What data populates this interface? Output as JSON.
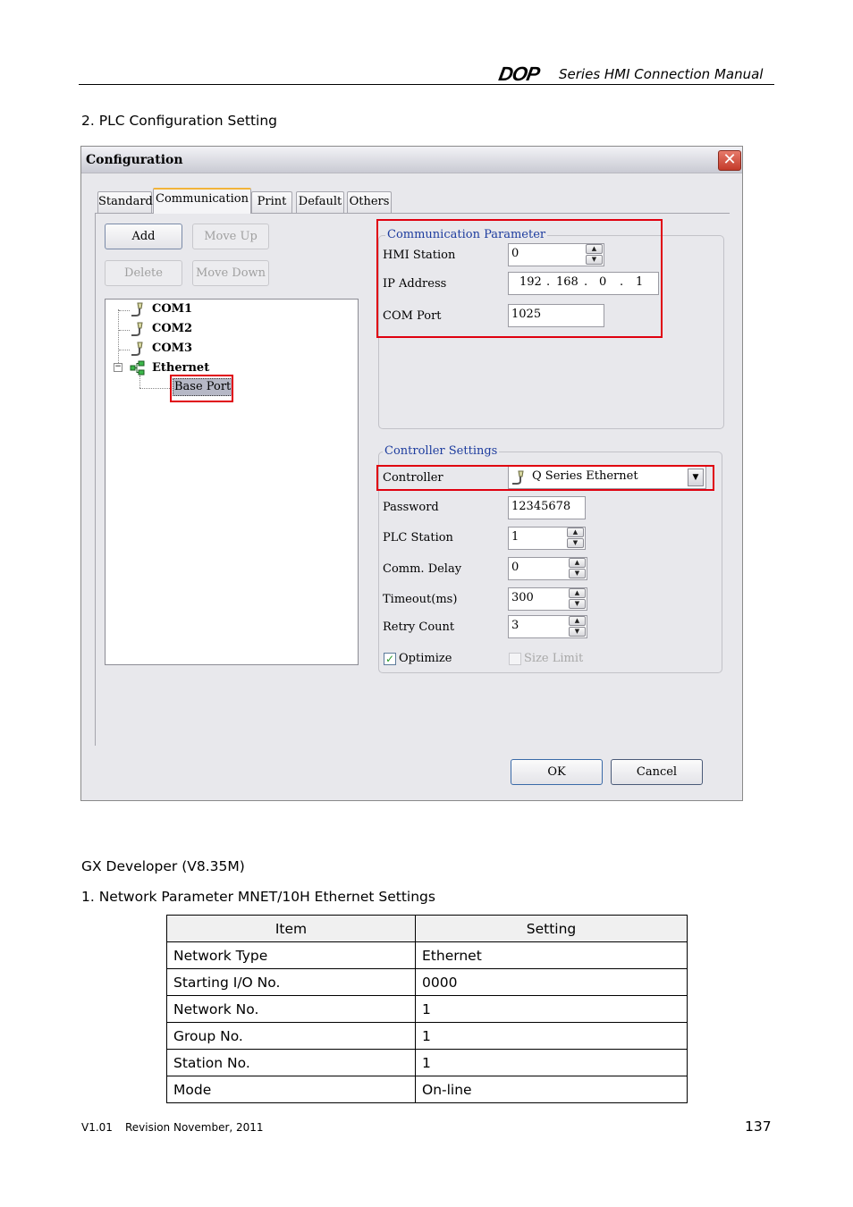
{
  "header": {
    "logo": "DOP",
    "title": "Series HMI Connection Manual"
  },
  "section1": "2.  PLC Configuration Setting",
  "dialog": {
    "title": "Configuration",
    "close_icon": "✕",
    "tabs": [
      {
        "label": "Standard",
        "active": false
      },
      {
        "label": "Communication",
        "active": true
      },
      {
        "label": "Print",
        "active": false
      },
      {
        "label": "Default",
        "active": false
      },
      {
        "label": "Others",
        "active": false
      }
    ],
    "buttons": {
      "add": "Add",
      "move_up": "Move Up",
      "delete": "Delete",
      "move_down": "Move Down",
      "ok": "OK",
      "cancel": "Cancel"
    },
    "tree": {
      "items": [
        {
          "label": "COM1",
          "icon": "serial-plug-icon"
        },
        {
          "label": "COM2",
          "icon": "serial-plug-icon"
        },
        {
          "label": "COM3",
          "icon": "serial-plug-icon"
        },
        {
          "label": "Ethernet",
          "icon": "network-icon",
          "expanded": true
        }
      ],
      "child_selected": "Base Port"
    },
    "comm_param": {
      "legend": "Communication Parameter",
      "hmi_station_label": "HMI Station",
      "hmi_station_value": "0",
      "ip_label": "IP Address",
      "ip": [
        "192",
        "168",
        "0",
        "1"
      ],
      "com_port_label": "COM Port",
      "com_port_value": "1025"
    },
    "controller_settings": {
      "legend": "Controller Settings",
      "controller_label": "Controller",
      "controller_value": "Q Series Ethernet",
      "password_label": "Password",
      "password_value": "12345678",
      "plc_station_label": "PLC Station",
      "plc_station_value": "1",
      "comm_delay_label": "Comm. Delay",
      "comm_delay_value": "0",
      "timeout_label": "Timeout(ms)",
      "timeout_value": "300",
      "retry_label": "Retry Count",
      "retry_value": "3",
      "optimize_label": "Optimize",
      "optimize_checked": true,
      "size_limit_label": "Size Limit",
      "size_limit_checked": false
    }
  },
  "gx_heading": "GX Developer (V8.35M)",
  "section2": "1.  Network Parameter MNET/10H Ethernet Settings",
  "table": {
    "headers": [
      "Item",
      "Setting"
    ],
    "rows": [
      [
        "Network Type",
        "Ethernet"
      ],
      [
        "Starting I/O No.",
        "0000"
      ],
      [
        "Network No.",
        "1"
      ],
      [
        "Group No.",
        "1"
      ],
      [
        "Station No.",
        "1"
      ],
      [
        "Mode",
        "On-line"
      ]
    ]
  },
  "footer": {
    "version": "V1.01",
    "revision": "Revision November, 2011",
    "page_number": "137"
  }
}
